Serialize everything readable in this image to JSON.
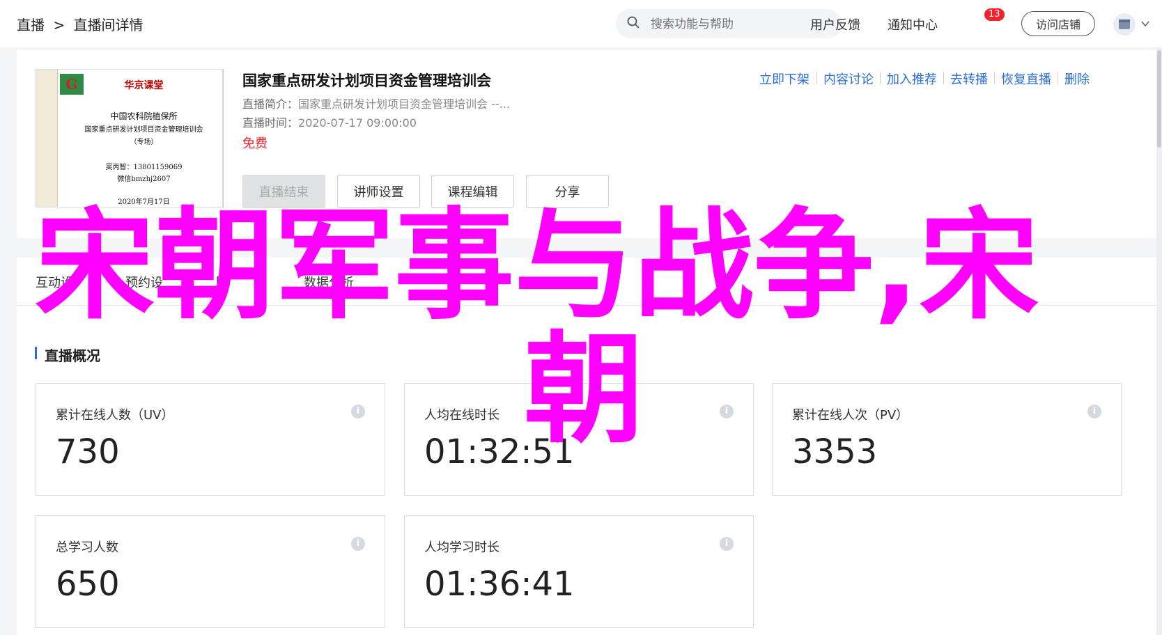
{
  "breadcrumb": {
    "root": "直播",
    "sep": ">",
    "current": "直播间详情"
  },
  "search": {
    "placeholder": "搜索功能与帮助"
  },
  "topnav": {
    "feedback": "用户反馈",
    "notifications": "通知中心",
    "notification_count": "13",
    "visit_store": "访问店铺"
  },
  "course": {
    "title": "国家重点研发计划项目资金管理培训会",
    "intro_label": "直播简介：",
    "intro": "国家重点研发计划项目资金管理培训会 --...",
    "time_label": "直播时间：",
    "time": "2020-07-17 09:00:00",
    "price": "免费",
    "cover": {
      "header": "华京课堂",
      "line1": "中国农科院植保所",
      "line2": "国家重点研发计划项目资金管理培训会",
      "line3": "（专场）",
      "line4": "吴丙智：13801159069",
      "line5": "微信bmzhj2607",
      "line6": "2020年7月17日"
    },
    "actions": [
      "立即下架",
      "内容讨论",
      "加入推荐",
      "去转播",
      "恢复直播",
      "删除"
    ],
    "buttons": {
      "end": "直播结束",
      "teacher": "讲师设置",
      "edit": "课程编辑",
      "share": "分享"
    }
  },
  "tabs": [
    "互动设",
    "预约设",
    "回",
    "数据分析"
  ],
  "overview": {
    "title": "直播概况",
    "stats": [
      {
        "label": "累计在线人数（UV）",
        "value": "730"
      },
      {
        "label": "人均在线时长",
        "value": "01:32:51"
      },
      {
        "label": "累计在线人次（PV）",
        "value": "3353"
      },
      {
        "label": "总学习人数",
        "value": "650"
      },
      {
        "label": "人均学习时长",
        "value": "01:36:41"
      }
    ]
  },
  "overlay": {
    "line1": "宋朝军事与战争,宋",
    "line2": "朝"
  },
  "colors": {
    "link": "#2d6ed6",
    "price": "#f5222d",
    "overlay": "#ff00ff",
    "badge": "#f5222d"
  }
}
